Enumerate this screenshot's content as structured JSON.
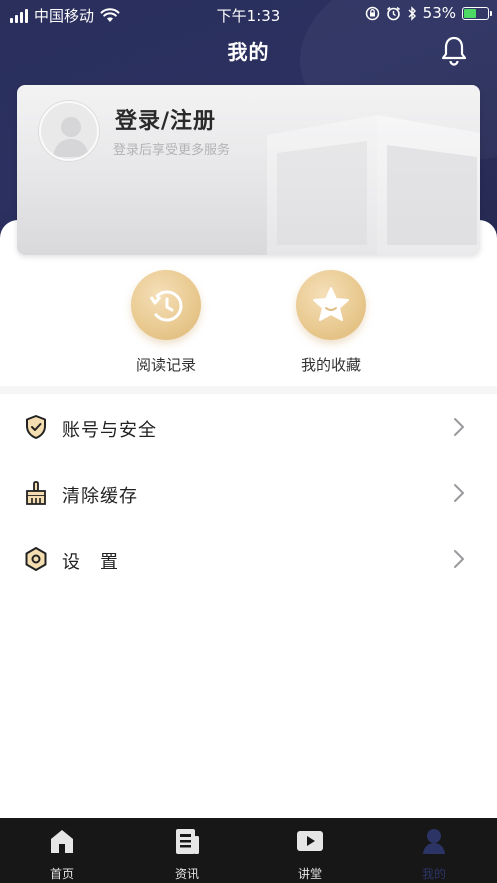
{
  "status_bar": {
    "carrier": "中国移动",
    "time": "下午1:33",
    "battery_percent": "53%",
    "battery_level": 0.53
  },
  "header": {
    "title": "我的"
  },
  "login_card": {
    "title": "登录/注册",
    "subtitle": "登录后享受更多服务"
  },
  "quick_actions": [
    {
      "label": "阅读记录",
      "icon": "history-icon"
    },
    {
      "label": "我的收藏",
      "icon": "star-icon"
    }
  ],
  "menu": [
    {
      "label": "账号与安全",
      "icon": "shield-check-icon"
    },
    {
      "label": "清除缓存",
      "icon": "broom-icon"
    },
    {
      "label": "设　置",
      "icon": "hexagon-settings-icon"
    }
  ],
  "tab_bar": {
    "tabs": [
      {
        "label": "首页",
        "icon": "home-icon"
      },
      {
        "label": "资讯",
        "icon": "news-icon"
      },
      {
        "label": "讲堂",
        "icon": "play-icon"
      },
      {
        "label": "我的",
        "icon": "user-icon"
      }
    ],
    "active_index": 3
  },
  "colors": {
    "header_bg": "#2a2f5c",
    "accent_gold": "#e8c88e",
    "active_tab": "#2c3466",
    "tab_bar_bg": "#171717"
  }
}
